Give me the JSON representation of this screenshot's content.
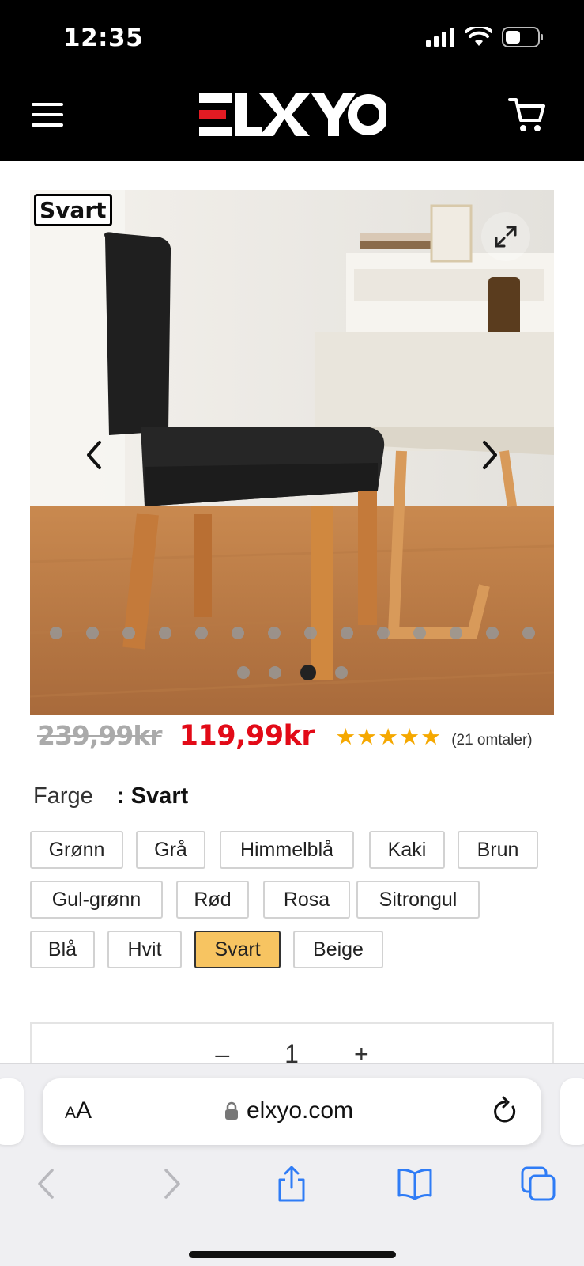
{
  "status_bar": {
    "time": "12:35"
  },
  "header": {
    "logo_text": "ELXYO"
  },
  "gallery": {
    "variant_tag": "Svart",
    "dots_row1": 14,
    "dots_row2": 4,
    "active_dot": 3
  },
  "pricing": {
    "old_price": "239,99kr",
    "new_price": "119,99kr",
    "stars": "★★★★★",
    "rating": 5,
    "reviews": "(21 omtaler)"
  },
  "color": {
    "label": "Farge",
    "selected": ": Svart",
    "options": [
      "Grønn",
      "Grå",
      "Himmelblå",
      "Kaki",
      "Brun",
      "Gul-grønn",
      "Rød",
      "Rosa",
      "Sitrongul",
      "Blå",
      "Hvit",
      "Svart",
      "Beige"
    ],
    "selected_option": "Svart"
  },
  "quantity": {
    "minus": "–",
    "value": "1",
    "plus": "+"
  },
  "browser": {
    "aa_small": "A",
    "aa_large": "A",
    "url": "elxyo.com"
  },
  "colors": {
    "price_red": "#e20a17",
    "star": "#f5a800",
    "selected_bg": "#f7c461",
    "safari_blue": "#2f7cf6",
    "logo_red": "#e31b23"
  }
}
